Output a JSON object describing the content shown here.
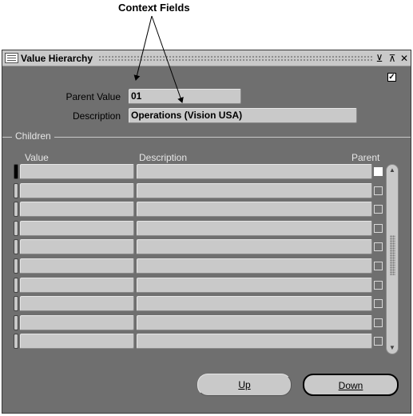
{
  "annotation": {
    "label": "Context Fields"
  },
  "window": {
    "title": "Value Hierarchy",
    "controls": {
      "minimize": "⊻",
      "maximize": "⊼",
      "close": "✕"
    }
  },
  "form": {
    "checkbox_checked": true,
    "parent_value_label": "Parent Value",
    "parent_value": "01",
    "description_label": "Description",
    "description": "Operations (Vision USA)"
  },
  "children": {
    "group_title": "Children",
    "headers": {
      "value": "Value",
      "description": "Description",
      "parent": "Parent"
    },
    "rows": [
      {
        "value": "",
        "description": "",
        "parent": false,
        "active": true
      },
      {
        "value": "",
        "description": "",
        "parent": false,
        "active": false
      },
      {
        "value": "",
        "description": "",
        "parent": false,
        "active": false
      },
      {
        "value": "",
        "description": "",
        "parent": false,
        "active": false
      },
      {
        "value": "",
        "description": "",
        "parent": false,
        "active": false
      },
      {
        "value": "",
        "description": "",
        "parent": false,
        "active": false
      },
      {
        "value": "",
        "description": "",
        "parent": false,
        "active": false
      },
      {
        "value": "",
        "description": "",
        "parent": false,
        "active": false
      },
      {
        "value": "",
        "description": "",
        "parent": false,
        "active": false
      },
      {
        "value": "",
        "description": "",
        "parent": false,
        "active": false
      }
    ]
  },
  "buttons": {
    "up": "Up",
    "down": "Down"
  }
}
